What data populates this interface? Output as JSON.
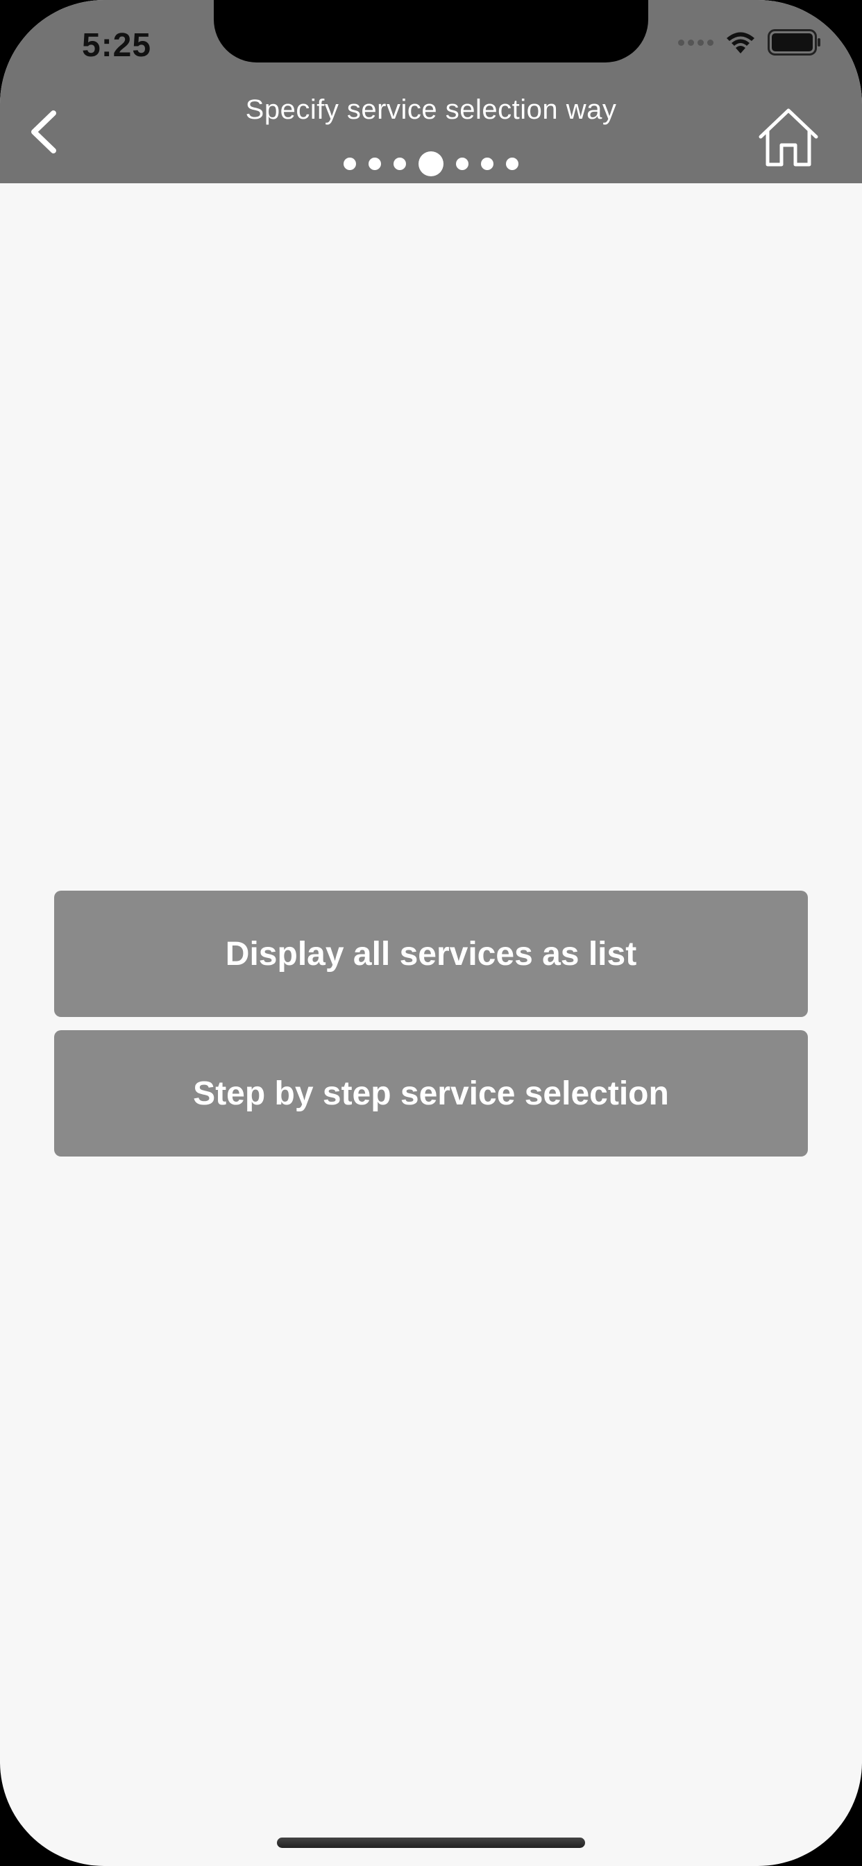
{
  "status_bar": {
    "time": "5:25"
  },
  "nav_bar": {
    "title": "Specify service selection way",
    "back_icon": "chevron-left-icon",
    "home_icon": "home-icon",
    "page_indicator": {
      "total": 7,
      "current": 4
    }
  },
  "options": {
    "list_label": "Display all services as list",
    "step_label": "Step by step service selection"
  },
  "colors": {
    "nav_background": "#737373",
    "content_background": "#f7f7f7",
    "button_background": "#8a8a8a",
    "button_text": "#ffffff"
  }
}
